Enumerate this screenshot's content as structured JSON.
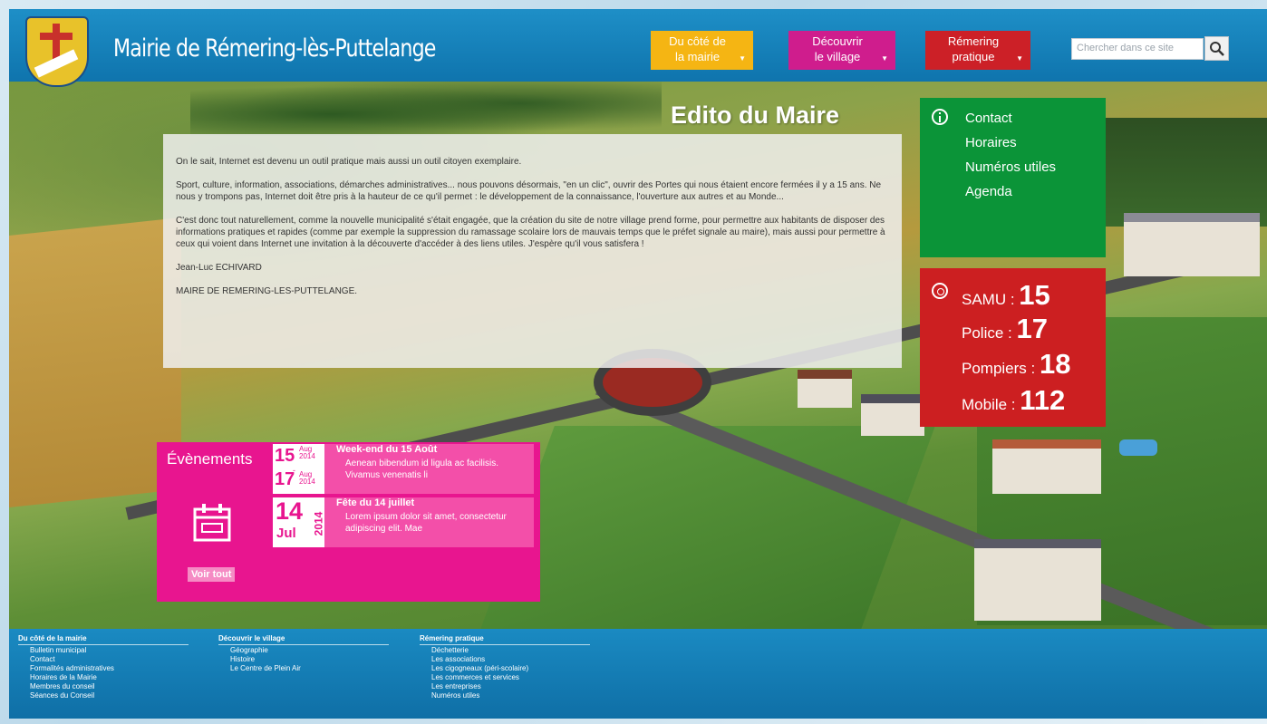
{
  "header": {
    "site_title": "Mairie de Rémering-lès-Puttelange",
    "nav": [
      {
        "label_line1": "Du côté de",
        "label_line2": "la mairie"
      },
      {
        "label_line1": "Découvrir",
        "label_line2": "le village"
      },
      {
        "label_line1": "Rémering",
        "label_line2": "pratique"
      }
    ],
    "search_placeholder": "Chercher dans ce site"
  },
  "edito": {
    "title": "Edito du Maire",
    "paragraphs": [
      "On le sait, Internet est devenu un outil pratique mais aussi un outil citoyen exemplaire.",
      "Sport, culture, information, associations, démarches administratives... nous pouvons désormais, \"en un clic\", ouvrir des Portes qui nous étaient encore fermées il y a 15 ans. Ne nous y trompons pas, Internet doit être pris à la hauteur de ce qu'il permet : le développement de la connaissance, l'ouverture aux autres et au Monde...",
      "C'est donc tout naturellement, comme la nouvelle municipalité s'était engagée, que la création du site de notre village prend forme, pour permettre aux habitants de disposer des informations pratiques et rapides (comme par exemple la suppression du ramassage scolaire lors de mauvais temps que le préfet signale au maire), mais aussi pour permettre à ceux qui voient dans Internet une invitation à la découverte d'accéder à des liens utiles. J'espère qu'il vous satisfera !",
      "Jean-Luc ECHIVARD",
      "MAIRE DE REMERING-LES-PUTTELANGE."
    ]
  },
  "info": {
    "links": [
      "Contact",
      "Horaires",
      "Numéros utiles",
      "Agenda"
    ]
  },
  "emergency": [
    {
      "label": "SAMU : ",
      "number": "15"
    },
    {
      "label": "Police : ",
      "number": "17"
    },
    {
      "label": "Pompiers : ",
      "number": "18"
    },
    {
      "label": "Mobile : ",
      "number": "112"
    }
  ],
  "events": {
    "title": "Évènements",
    "see_all": "Voir tout",
    "items": [
      {
        "day_start": "15",
        "month_start": "Aug",
        "year_start": "2014",
        "day_end": "17",
        "month_end": "Aug",
        "year_end": "2014",
        "title": "Week-end du 15 Août",
        "text": "Aenean bibendum id ligula ac facilisis. Vivamus venenatis li"
      },
      {
        "day": "14",
        "month": "Jul",
        "year": "2014",
        "title": "Fête du 14 juillet",
        "text": "Lorem ipsum dolor sit amet, consectetur adipiscing elit. Mae"
      }
    ]
  },
  "footer": {
    "columns": [
      {
        "heading": "Du côté de la mairie",
        "items": [
          "Bulletin municipal",
          "Contact",
          "Formalités administratives",
          "Horaires de la Mairie",
          "Membres du conseil",
          "Séances du Conseil"
        ]
      },
      {
        "heading": "Découvrir le village",
        "items": [
          "Géographie",
          "Histoire",
          "Le Centre de Plein Air"
        ]
      },
      {
        "heading": "Rémering pratique",
        "items": [
          "Déchetterie",
          "Les associations",
          "Les cigogneaux (péri-scolaire)",
          "Les commerces et services",
          "Les entreprises",
          "Numéros utiles"
        ]
      }
    ]
  },
  "colors": {
    "header_blue": "#1e8fc7",
    "nav_yellow": "#f5b513",
    "nav_magenta": "#cf1d8d",
    "nav_red": "#cc2027",
    "info_green": "#0b9438",
    "emergency_red": "#cc1f21",
    "events_pink": "#e8158f"
  }
}
